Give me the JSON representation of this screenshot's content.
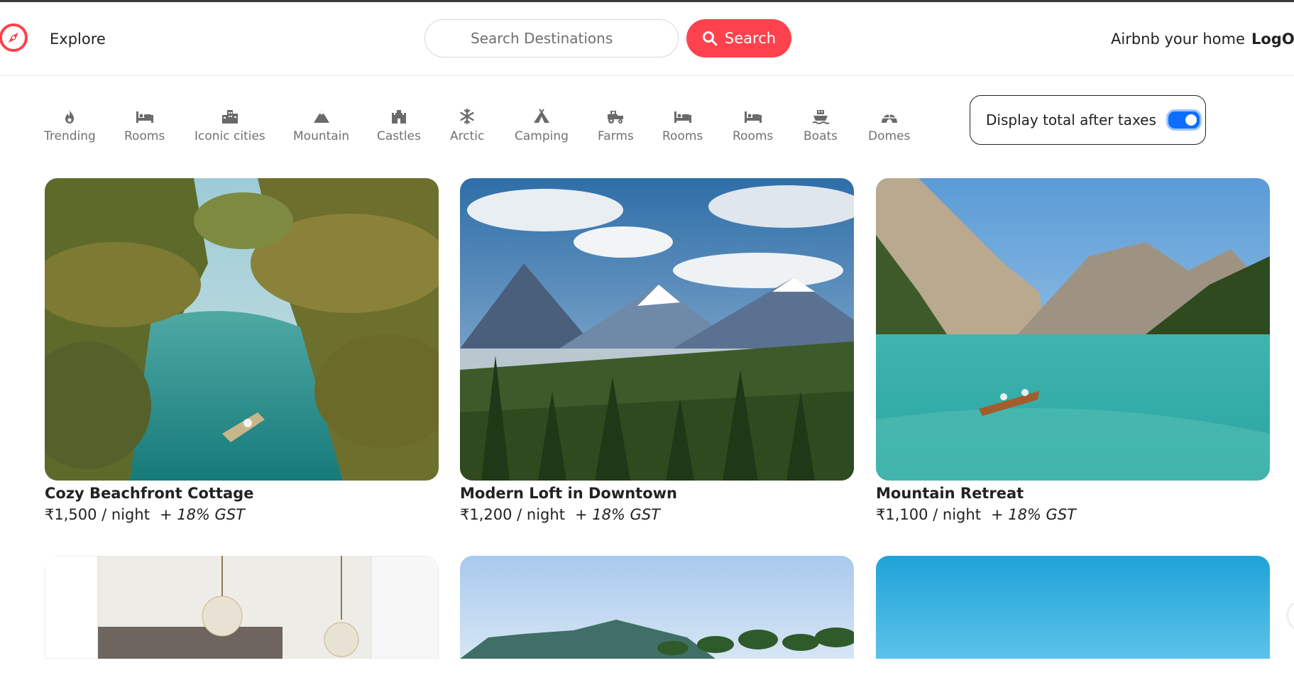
{
  "navbar": {
    "explore_label": "Explore",
    "search_placeholder": "Search Destinations",
    "search_button_label": "Search",
    "host_link_label": "Airbnb your home",
    "logout_label": "LogOut"
  },
  "filters": [
    {
      "label": "Trending",
      "icon": "fire-icon"
    },
    {
      "label": "Rooms",
      "icon": "bed-icon"
    },
    {
      "label": "Iconic cities",
      "icon": "city-icon"
    },
    {
      "label": "Mountain",
      "icon": "mountain-icon"
    },
    {
      "label": "Castles",
      "icon": "castle-icon"
    },
    {
      "label": "Arctic",
      "icon": "snowflake-icon"
    },
    {
      "label": "Camping",
      "icon": "tent-icon"
    },
    {
      "label": "Farms",
      "icon": "tractor-icon"
    },
    {
      "label": "Rooms",
      "icon": "bed-icon"
    },
    {
      "label": "Rooms",
      "icon": "bed-icon"
    },
    {
      "label": "Boats",
      "icon": "ship-icon"
    },
    {
      "label": "Domes",
      "icon": "igloo-icon"
    }
  ],
  "tax_toggle": {
    "label": "Display total after taxes",
    "enabled": true
  },
  "listings": [
    {
      "title": "Cozy Beachfront Cottage",
      "price": "₹1,500 / night",
      "gst": "+ 18% GST"
    },
    {
      "title": "Modern Loft in Downtown",
      "price": "₹1,200 / night",
      "gst": "+ 18% GST"
    },
    {
      "title": "Mountain Retreat",
      "price": "₹1,100 / night",
      "gst": "+ 18% GST"
    },
    {
      "title": "",
      "price": "",
      "gst": ""
    },
    {
      "title": "",
      "price": "",
      "gst": ""
    },
    {
      "title": "",
      "price": "",
      "gst": ""
    }
  ],
  "colors": {
    "brand": "#fe424d",
    "toggle_on": "#0d6efd",
    "filter_text": "#717171"
  }
}
